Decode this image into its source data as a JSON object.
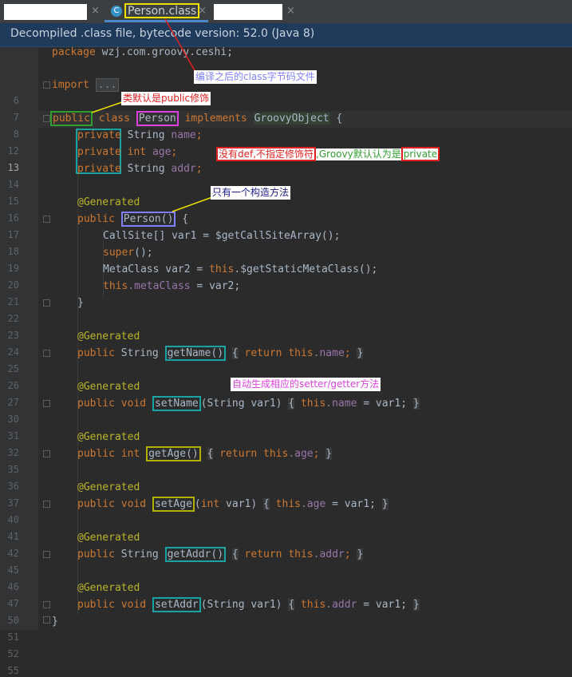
{
  "tabs": {
    "active_label": "Person.class",
    "active_icon_letter": "C",
    "close_glyph": "×"
  },
  "infobar": {
    "text": "Decompiled .class file, bytecode version: 52.0 (Java 8)"
  },
  "gutter": {
    "line_numbers": [
      "6",
      "7",
      "8",
      "12",
      "13",
      "14",
      "15",
      "16",
      "17",
      "18",
      "19",
      "20",
      "21",
      "22",
      "23",
      "24",
      "25",
      "26",
      "27",
      "30",
      "31",
      "32",
      "35",
      "36",
      "37",
      "40",
      "41",
      "42",
      "45",
      "46",
      "47",
      "50",
      "51",
      "52",
      "55"
    ]
  },
  "code": {
    "l6": {
      "kw": "package",
      "text": " wzj.com.groovy.ceshi;"
    },
    "l8": {
      "kw": "import",
      "fold": "..."
    },
    "l13": {
      "kw1": "public",
      "kw2": "class",
      "cls": "Person",
      "kw3": "implements",
      "iface": "GroovyObject",
      "tail": " {"
    },
    "l14": {
      "kw": "private",
      "rest": " String ",
      "fld": "name",
      "end": ";"
    },
    "l15": {
      "kw": "private",
      "type": " int ",
      "fld": "age",
      "end": ";"
    },
    "l16": {
      "kw": "private",
      "rest": " String ",
      "fld": "addr",
      "end": ";"
    },
    "generated": "@Generated",
    "l19": {
      "kw": "public",
      "ctor": "Person()",
      "tail": " {"
    },
    "l20": "CallSite[] var1 = $getCallSiteArray();",
    "l21": {
      "kw": "super",
      "tail": "();"
    },
    "l22": {
      "pre": "MetaClass var2 = ",
      "kw": "this",
      "tail": ".$getStaticMetaClass();"
    },
    "l23": {
      "kw": "this",
      "fld": ".metaClass",
      "tail": " = var2;"
    },
    "close_brace": "}",
    "l27": {
      "kw": "public",
      "type": " String ",
      "fn": "getName()",
      "body_kw": "return",
      "body_this": "this",
      "body_fld": ".name",
      "body_end": ";"
    },
    "l32": {
      "kw": "public",
      "type": "void",
      "fn": "setName",
      "params": "(String var1) ",
      "body_this": "this",
      "body_fld": ".name",
      "body_end": " = var1;"
    },
    "l37": {
      "kw": "public",
      "type": "int",
      "fn": "getAge()",
      "body_kw": "return",
      "body_this": "this",
      "body_fld": ".age",
      "body_end": ";"
    },
    "l42": {
      "kw": "public",
      "type": "void",
      "fn": "setAge",
      "params_kw": "int",
      "params": " var1) ",
      "body_this": "this",
      "body_fld": ".age",
      "body_end": " = var1;"
    },
    "l47": {
      "kw": "public",
      "type": " String ",
      "fn": "getAddr()",
      "body_kw": "return",
      "body_this": "this",
      "body_fld": ".addr",
      "body_end": ";"
    },
    "l52": {
      "kw": "public",
      "type": "void",
      "fn": "setAddr",
      "params": "(String var1) ",
      "body_this": "this",
      "body_fld": ".addr",
      "body_end": " = var1;"
    },
    "brace_open": "{",
    "brace_close": "}"
  },
  "annotations": {
    "bytecode_note": "编译之后的class字节码文件",
    "default_public": "类默认是public修饰",
    "no_def": "没有def,不指定修饰符",
    "groovy_default": ",Groovy默认认为是",
    "private_word": "private",
    "one_ctor": "只有一个构造方法",
    "auto_gen": "自动生成相应的setter/getter方法"
  },
  "colors": {
    "keyword": "#cc7832",
    "annotation": "#bbb529",
    "field": "#9876aa",
    "method": "#ffc66d",
    "box_yellow": "#f0e000",
    "box_magenta": "#e040e0",
    "box_teal": "#1aa3a3",
    "box_purple": "#8080ff",
    "box_olive": "#b0b000",
    "box_green": "#2e9e2e",
    "box_red": "#e02020"
  }
}
